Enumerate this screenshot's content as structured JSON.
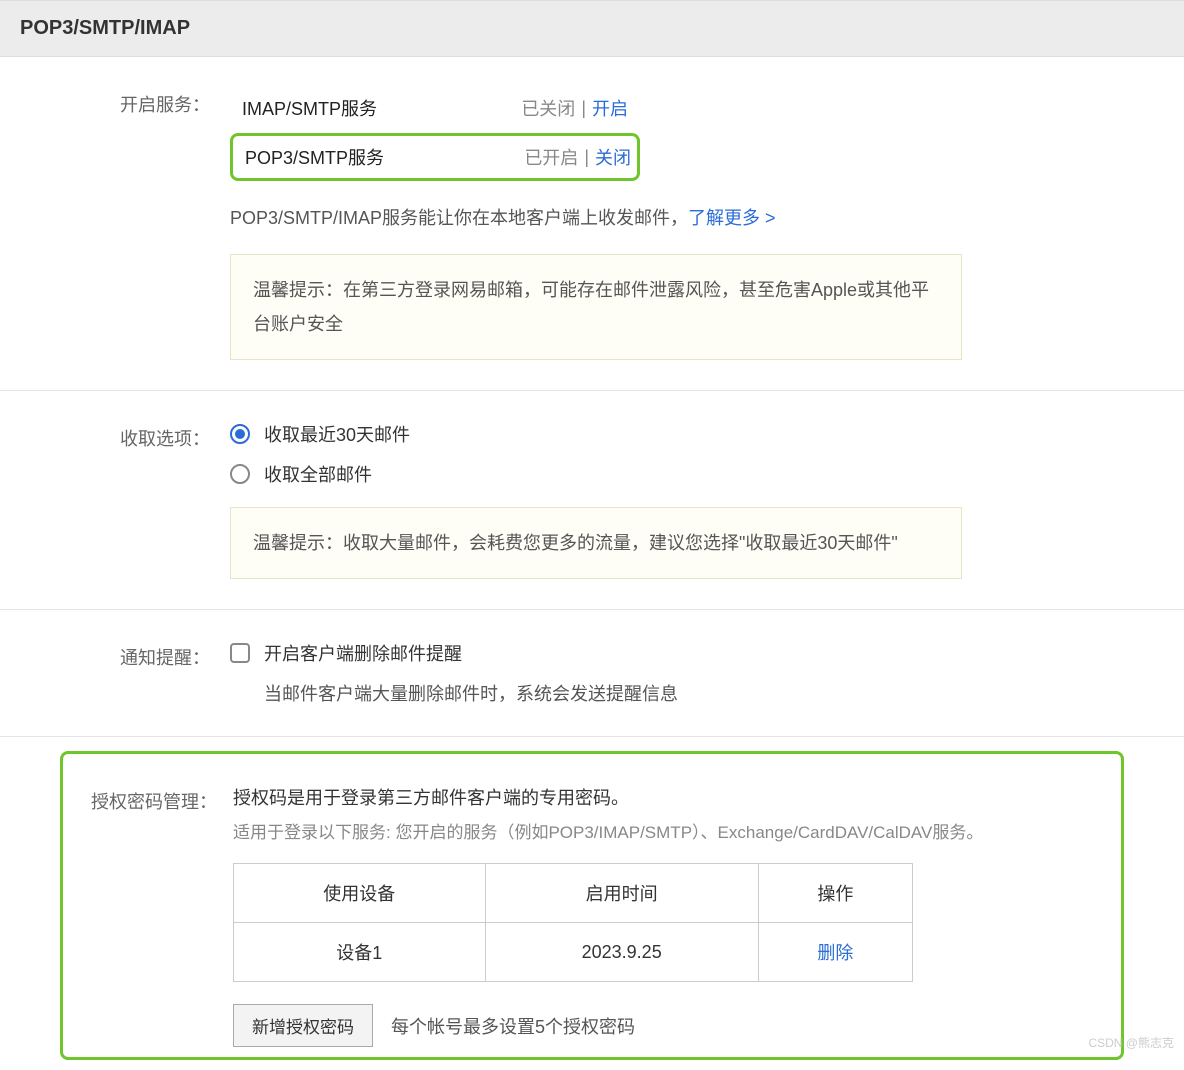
{
  "header": {
    "title": "POP3/SMTP/IMAP"
  },
  "services": {
    "label": "开启服务：",
    "imap": {
      "name": "IMAP/SMTP服务",
      "status": "已关闭",
      "action": "开启"
    },
    "pop3": {
      "name": "POP3/SMTP服务",
      "status": "已开启",
      "action": "关闭"
    },
    "desc_prefix": "POP3/SMTP/IMAP服务能让你在本地客户端上收发邮件，",
    "learn_more": "了解更多 >",
    "tip": "温馨提示：在第三方登录网易邮箱，可能存在邮件泄露风险，甚至危害Apple或其他平台账户安全"
  },
  "fetch": {
    "label": "收取选项：",
    "opt1": "收取最近30天邮件",
    "opt2": "收取全部邮件",
    "tip": "温馨提示：收取大量邮件，会耗费您更多的流量，建议您选择\"收取最近30天邮件\""
  },
  "notify": {
    "label": "通知提醒：",
    "checkbox_label": "开启客户端删除邮件提醒",
    "desc": "当邮件客户端大量删除邮件时，系统会发送提醒信息"
  },
  "auth": {
    "label": "授权密码管理：",
    "desc1": "授权码是用于登录第三方邮件客户端的专用密码。",
    "desc2": "适用于登录以下服务: 您开启的服务（例如POP3/IMAP/SMTP）、Exchange/CardDAV/CalDAV服务。",
    "table": {
      "headers": [
        "使用设备",
        "启用时间",
        "操作"
      ],
      "row": {
        "device": "设备1",
        "time": "2023.9.25",
        "action": "删除"
      }
    },
    "add_btn": "新增授权密码",
    "add_note": "每个帐号最多设置5个授权密码"
  },
  "watermark": "CSDN @熊志克"
}
